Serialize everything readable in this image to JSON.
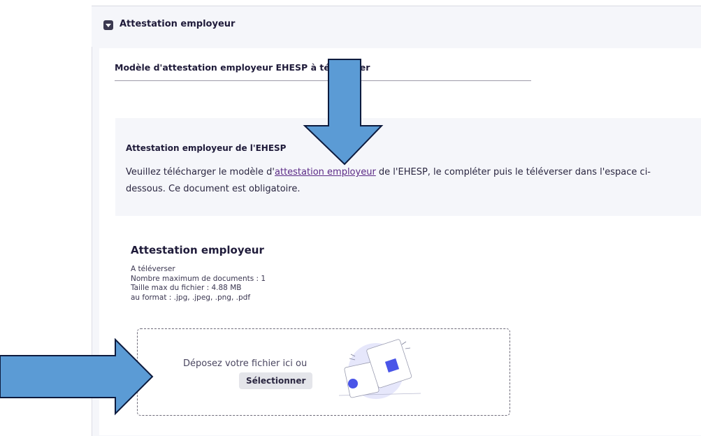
{
  "section": {
    "title": "Attestation employeur"
  },
  "document": {
    "heading": "Modèle d'attestation employeur EHESP à téléverser"
  },
  "info": {
    "title": "Attestation employeur de l'EHESP",
    "text_before": "Veuillez télécharger le modèle d'",
    "link": "attestation employeur",
    "text_after": " de l'EHESP, le compléter puis le téléverser dans l'espace ci-dessous. Ce document est obligatoire."
  },
  "upload": {
    "title": "Attestation employeur",
    "status": "A téléverser",
    "max_docs": "Nombre maximum de documents : 1",
    "max_size": "Taille max du fichier : 4.88 MB",
    "formats": "au format : .jpg, .jpeg, .png, .pdf",
    "drop_text": "Déposez votre fichier ici ou",
    "select_label": "Sélectionner"
  },
  "colors": {
    "arrow_fill": "#5b9bd5",
    "arrow_stroke": "#0d1b3e",
    "accent": "#4a55e8",
    "link": "#5b2a86"
  }
}
